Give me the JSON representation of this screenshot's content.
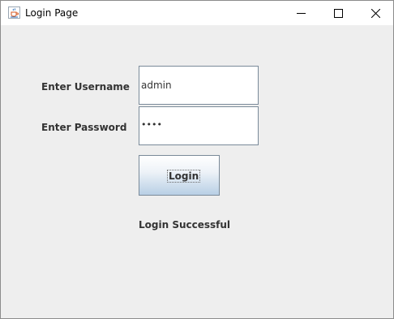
{
  "window": {
    "title": "Login Page",
    "app_icon": "java-cup-icon",
    "controls": {
      "minimize_icon": "minimize-icon",
      "maximize_icon": "maximize-icon",
      "close_icon": "close-icon"
    }
  },
  "form": {
    "username_label": "Enter Username",
    "username_value": "admin",
    "password_label": "Enter Password",
    "password_masked": "••••",
    "login_button_label": "Login",
    "status_text": "Login Successful"
  },
  "colors": {
    "background": "#eeeeee",
    "field_border": "#7a8a99",
    "button_gradient_bottom": "#b8cfe5",
    "label_text": "#333333"
  }
}
